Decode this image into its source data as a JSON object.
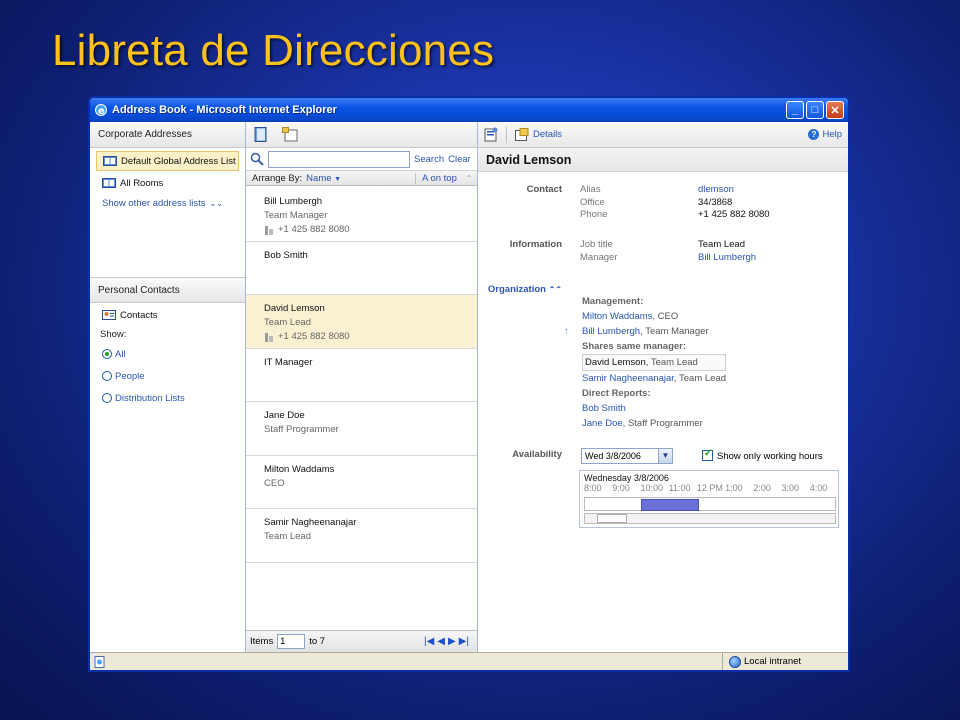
{
  "slide": {
    "title": "Libreta de Direcciones"
  },
  "window": {
    "title": "Address Book - Microsoft Internet Explorer"
  },
  "left": {
    "corporate_header": "Corporate Addresses",
    "items": [
      {
        "label": "Default Global Address List",
        "selected": true
      },
      {
        "label": "All Rooms",
        "selected": false
      }
    ],
    "show_other": "Show other address lists",
    "personal_header": "Personal Contacts",
    "contacts": "Contacts",
    "show_label": "Show:",
    "filters": [
      {
        "label": "All",
        "checked": true
      },
      {
        "label": "People",
        "checked": false
      },
      {
        "label": "Distribution Lists",
        "checked": false
      }
    ]
  },
  "middle": {
    "search_label": "Search",
    "clear_label": "Clear",
    "arrange_by": "Arrange By:",
    "arrange_field": "Name",
    "sort_order": "A on top",
    "contacts": [
      {
        "name": "Bill Lumbergh",
        "title": "Team Manager",
        "phone": "+1 425 882 8080"
      },
      {
        "name": "Bob Smith",
        "title": "",
        "phone": ""
      },
      {
        "name": "David Lemson",
        "title": "Team Lead",
        "phone": "+1 425 882 8080",
        "selected": true
      },
      {
        "name": "IT Manager",
        "title": "",
        "phone": ""
      },
      {
        "name": "Jane Doe",
        "title": "Staff Programmer",
        "phone": ""
      },
      {
        "name": "Milton Waddams",
        "title": "CEO",
        "phone": ""
      },
      {
        "name": "Samir Nagheenanajar",
        "title": "Team Lead",
        "phone": ""
      }
    ],
    "footer": {
      "items_label": "Items",
      "items_value": "1",
      "to_label": "to 7"
    }
  },
  "right": {
    "details_label": "Details",
    "help_label": "Help",
    "person_name": "David Lemson",
    "contact_label": "Contact",
    "alias_key": "Alias",
    "alias_val": "dlemson",
    "office_key": "Office",
    "office_val": "34/3868",
    "phone_key": "Phone",
    "phone_val": "+1 425 882 8080",
    "information_label": "Information",
    "jobtitle_key": "Job title",
    "jobtitle_val": "Team Lead",
    "manager_key": "Manager",
    "manager_val": "Bill Lumbergh",
    "organization_label": "Organization",
    "management_header": "Management:",
    "mgmt_1_name": "Milton Waddams",
    "mgmt_1_role": ", CEO",
    "mgmt_2_name": "Bill Lumbergh",
    "mgmt_2_role": ", Team Manager",
    "shares_header": "Shares same manager:",
    "peer_1_name": "David Lemson",
    "peer_1_role": ", Team Lead",
    "peer_2_name": "Samir Nagheenanajar",
    "peer_2_role": ", Team Lead",
    "reports_header": "Direct Reports:",
    "report_1_name": "Bob Smith",
    "report_2_name": "Jane Doe",
    "report_2_role": ", Staff Programmer",
    "availability_label": "Availability",
    "date_value": "Wed 3/8/2006",
    "working_hours_label": "Show only working hours",
    "working_hours_checked": true,
    "grid_day": "Wednesday 3/8/2006",
    "hours": [
      "8:00",
      "9:00",
      "10:00",
      "11:00",
      "12 PM",
      "1:00",
      "2:00",
      "3:00",
      "4:00"
    ]
  },
  "status": {
    "zone": "Local intranet"
  },
  "colors": {
    "title_yellow": "#ffc21a",
    "link_blue": "#2a55b3",
    "busy_block": "#6a70d8",
    "selected_row": "#faf0d2"
  }
}
